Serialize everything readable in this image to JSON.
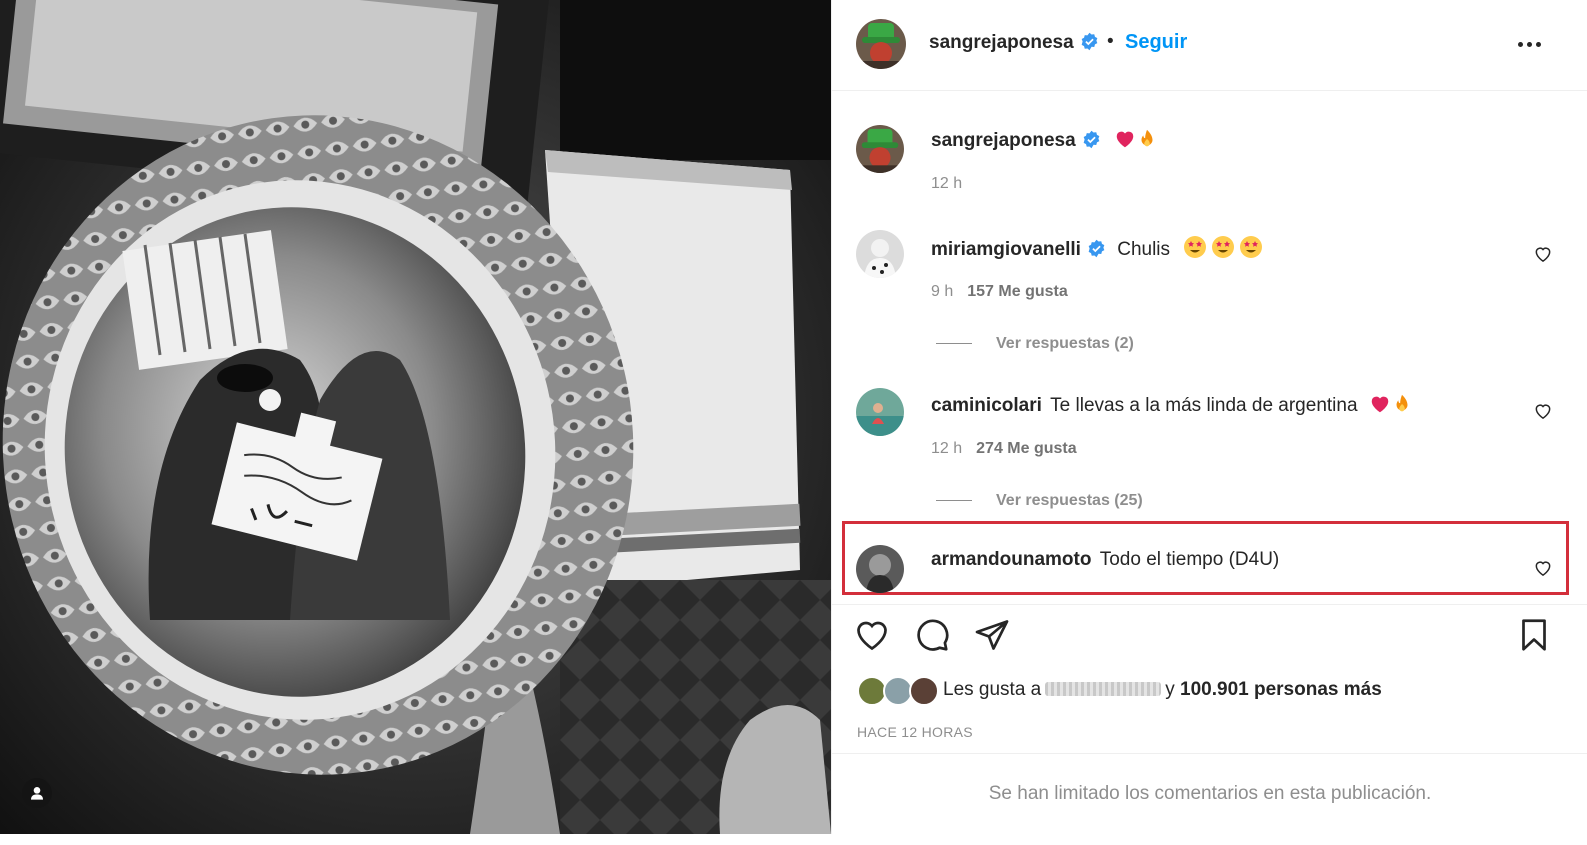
{
  "post": {
    "author": "sangrejaponesa",
    "follow_label": "Seguir",
    "separator": "•"
  },
  "caption": {
    "user": "sangrejaponesa",
    "emojis": [
      "red-heart",
      "fire"
    ],
    "time": "12 h"
  },
  "comments": [
    {
      "user": "miriamgiovanelli",
      "verified": true,
      "text": "Chulis",
      "emojis": [
        "star-struck",
        "star-struck",
        "star-struck"
      ],
      "time": "9 h",
      "likes": "157 Me gusta",
      "replies": "Ver respuestas (2)"
    },
    {
      "user": "caminicolari",
      "verified": false,
      "text": "Te llevas a la más linda de argentina",
      "emojis": [
        "red-heart",
        "fire"
      ],
      "time": "12 h",
      "likes": "274 Me gusta",
      "replies": "Ver respuestas (25)"
    },
    {
      "user": "armandounamoto",
      "verified": false,
      "text": "Todo el tiempo (D4U)",
      "highlighted": true
    }
  ],
  "likes": {
    "prefix": "Les gusta a",
    "connector": "y",
    "count_text": "100.901 personas más"
  },
  "timestamp": "HACE 12 HORAS",
  "comments_limited": "Se han limitado los comentarios en esta publicación.",
  "colors": {
    "accent": "#0095f6",
    "highlight_border": "#d32f3b",
    "verified": "#3897f0",
    "heart": "#e0245e"
  },
  "icons": [
    "verified-badge-icon",
    "more-options-icon",
    "heart-icon",
    "comment-icon",
    "share-icon",
    "bookmark-icon",
    "user-tag-icon"
  ]
}
